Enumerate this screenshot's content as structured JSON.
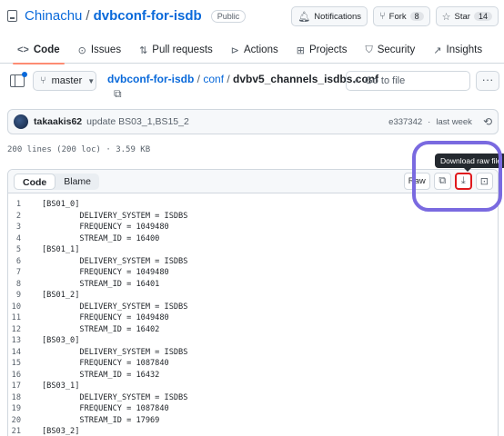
{
  "repo": {
    "owner": "Chinachu",
    "name": "dvbconf-for-isdb",
    "visibility": "Public",
    "buttons": {
      "notifications": "Notifications",
      "fork": "Fork",
      "fork_count": "8",
      "star": "Star",
      "star_count": "14"
    }
  },
  "tabs": [
    {
      "label": "Code",
      "icon": "code-icon"
    },
    {
      "label": "Issues",
      "icon": "issue-icon"
    },
    {
      "label": "Pull requests",
      "icon": "pull-request-icon"
    },
    {
      "label": "Actions",
      "icon": "play-icon"
    },
    {
      "label": "Projects",
      "icon": "table-icon"
    },
    {
      "label": "Security",
      "icon": "shield-icon"
    },
    {
      "label": "Insights",
      "icon": "graph-icon"
    }
  ],
  "file_nav": {
    "branch": "master",
    "path_repo": "dvbconf-for-isdb",
    "path_dir": "conf",
    "path_file": "dvbv5_channels_isdbs.conf",
    "goto_placeholder": "Go to file"
  },
  "commit": {
    "author": "takaakis62",
    "message": "update BS03_1,BS15_2",
    "sha": "e337342",
    "time": "last week"
  },
  "file_info": "200 lines (200 loc) · 3.59 KB",
  "viewer": {
    "tab_code": "Code",
    "tab_blame": "Blame",
    "raw": "Raw",
    "tooltip": "Download raw file"
  },
  "lines": [
    {
      "n": "1",
      "t": "[BS01_0]"
    },
    {
      "n": "2",
      "t": "        DELIVERY_SYSTEM = ISDBS"
    },
    {
      "n": "3",
      "t": "        FREQUENCY = 1049480"
    },
    {
      "n": "4",
      "t": "        STREAM_ID = 16400"
    },
    {
      "n": "5",
      "t": "[BS01_1]"
    },
    {
      "n": "6",
      "t": "        DELIVERY_SYSTEM = ISDBS"
    },
    {
      "n": "7",
      "t": "        FREQUENCY = 1049480"
    },
    {
      "n": "8",
      "t": "        STREAM_ID = 16401"
    },
    {
      "n": "9",
      "t": "[BS01_2]"
    },
    {
      "n": "10",
      "t": "        DELIVERY_SYSTEM = ISDBS"
    },
    {
      "n": "11",
      "t": "        FREQUENCY = 1049480"
    },
    {
      "n": "12",
      "t": "        STREAM_ID = 16402"
    },
    {
      "n": "13",
      "t": "[BS03_0]"
    },
    {
      "n": "14",
      "t": "        DELIVERY_SYSTEM = ISDBS"
    },
    {
      "n": "15",
      "t": "        FREQUENCY = 1087840"
    },
    {
      "n": "16",
      "t": "        STREAM_ID = 16432"
    },
    {
      "n": "17",
      "t": "[BS03_1]"
    },
    {
      "n": "18",
      "t": "        DELIVERY_SYSTEM = ISDBS"
    },
    {
      "n": "19",
      "t": "        FREQUENCY = 1087840"
    },
    {
      "n": "20",
      "t": "        STREAM_ID = 17969"
    },
    {
      "n": "21",
      "t": "[BS03_2]"
    }
  ]
}
